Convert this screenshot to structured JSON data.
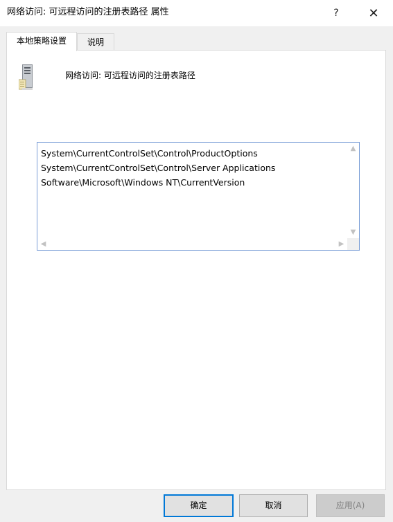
{
  "window": {
    "title": "网络访问: 可远程访问的注册表路径 属性",
    "help_label": "?",
    "close_label": "✕"
  },
  "tabs": [
    {
      "label": "本地策略设置",
      "active": true
    },
    {
      "label": "说明",
      "active": false
    }
  ],
  "policy": {
    "icon": "server-icon",
    "name": "网络访问: 可远程访问的注册表路径"
  },
  "registry_paths": [
    "System\\CurrentControlSet\\Control\\ProductOptions",
    "System\\CurrentControlSet\\Control\\Server Applications",
    "Software\\Microsoft\\Windows NT\\CurrentVersion"
  ],
  "scroll_arrows": {
    "up": "▲",
    "down": "▼",
    "left": "◀",
    "right": "▶"
  },
  "buttons": {
    "ok": "确定",
    "cancel": "取消",
    "apply": "应用(A)"
  },
  "colors": {
    "accent": "#0078d7",
    "listbox_border": "#7a9ed6",
    "dialog_bg": "#f0f0f0"
  }
}
